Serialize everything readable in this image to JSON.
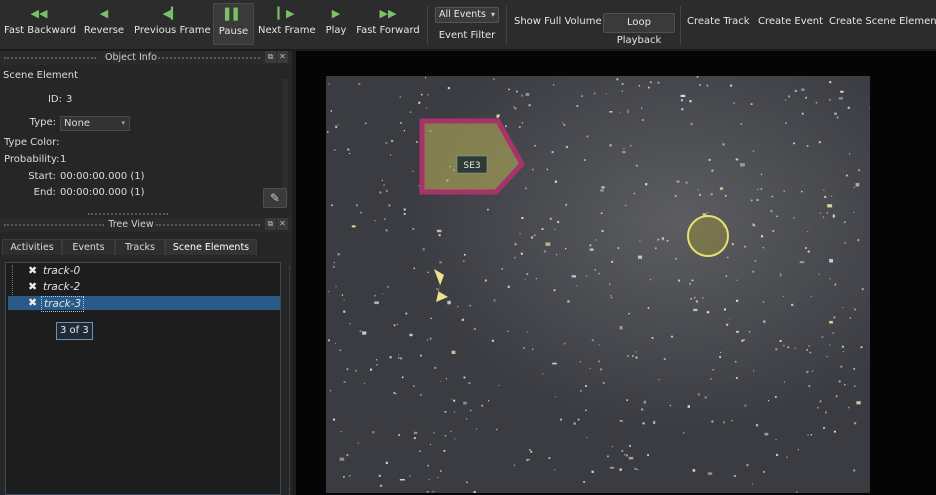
{
  "toolbar": {
    "buttons": [
      {
        "label": "Fast Backward",
        "icon": "fast-backward-icon",
        "glyph": "◀◀"
      },
      {
        "label": "Reverse",
        "icon": "reverse-icon",
        "glyph": "◀"
      },
      {
        "label": "Previous Frame",
        "icon": "previous-frame-icon",
        "glyph": "◀▎"
      },
      {
        "label": "Pause",
        "icon": "pause-icon",
        "glyph": "▌▌"
      },
      {
        "label": "Next Frame",
        "icon": "next-frame-icon",
        "glyph": "▎▶"
      },
      {
        "label": "Play",
        "icon": "play-icon",
        "glyph": "▶"
      },
      {
        "label": "Fast Forward",
        "icon": "fast-forward-icon",
        "glyph": "▶▶"
      }
    ],
    "event_filter_value": "All Events",
    "event_filter_label": "Event Filter",
    "show_full_volume": "Show Full Volume",
    "loop_playback": "Loop Playback",
    "create_track": "Create Track",
    "create_event": "Create Event",
    "create_scene_element": "Create Scene Element"
  },
  "object_info": {
    "title": "Object Info",
    "group": "Scene Element",
    "id_label": "ID:",
    "id_value": "3",
    "type_label": "Type:",
    "type_value": "None",
    "type_color_label": "Type Color:",
    "probability_label": "Probability:",
    "probability_value": "1",
    "start_label": "Start:",
    "start_value": "00:00:00.000 (1)",
    "end_label": "End:",
    "end_value": "00:00:00.000 (1)"
  },
  "tree_view": {
    "title": "Tree View",
    "tabs": [
      "Activities",
      "Events",
      "Tracks",
      "Scene Elements"
    ],
    "active_tab": "Scene Elements",
    "items": [
      {
        "name": "track-0",
        "selected": false
      },
      {
        "name": "track-2",
        "selected": false
      },
      {
        "name": "track-3",
        "selected": true
      }
    ],
    "tooltip": "3 of 3"
  },
  "video": {
    "scene_label": "SE3",
    "polygon_color": "#a8326a",
    "circle_color": "#e8e070"
  },
  "colors": {
    "play_icons": "#79c267",
    "selection": "#2a5a8a"
  }
}
